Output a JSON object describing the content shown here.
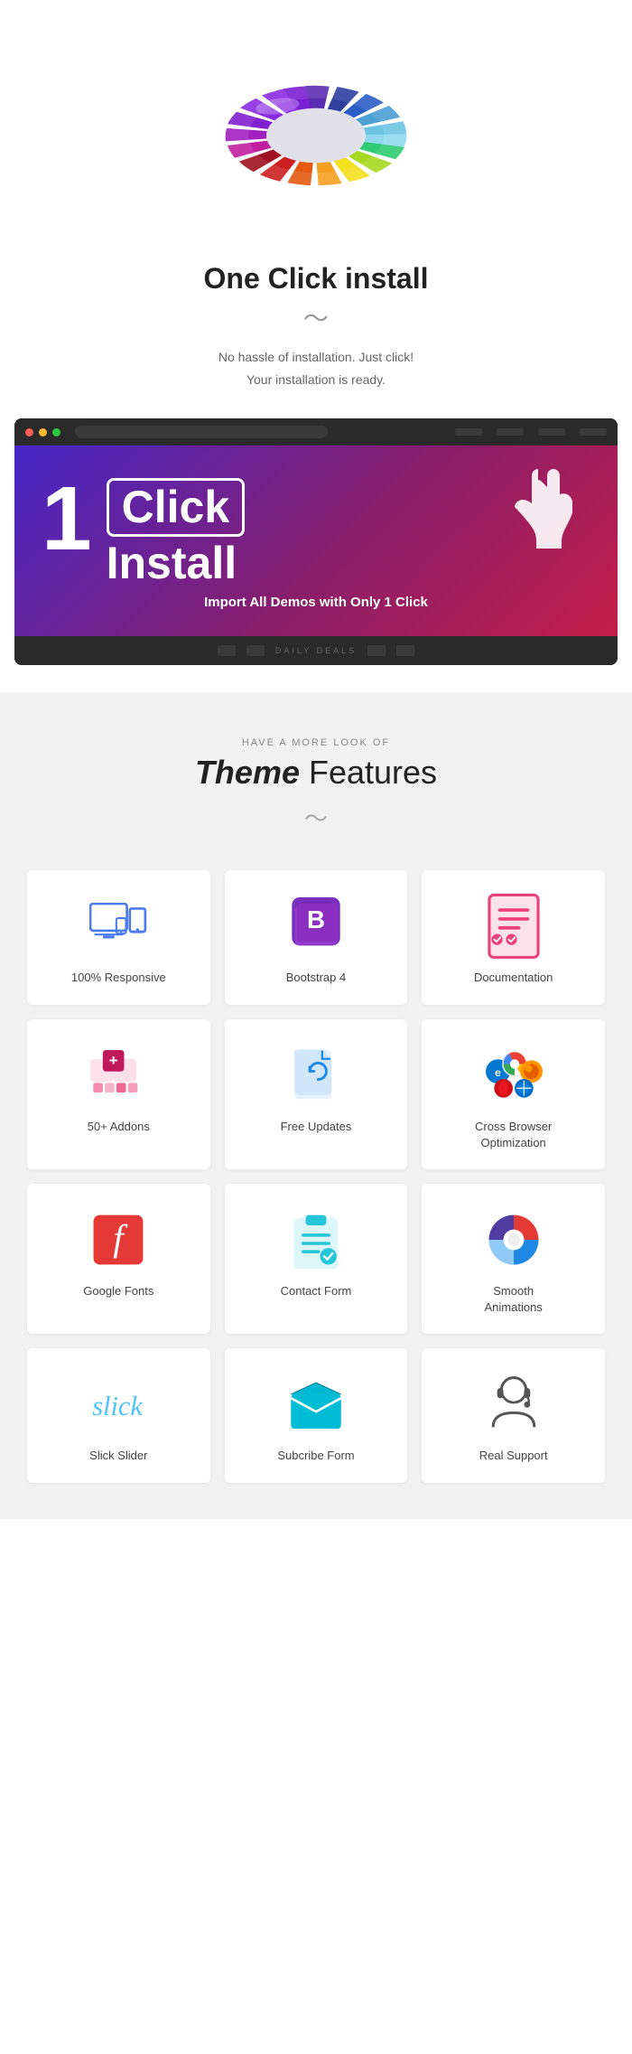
{
  "hero": {
    "title_bold": "One Click install",
    "divider_char": "〜",
    "desc_line1": "No hassle of installation. Just click!",
    "desc_line2": "Your installation is ready."
  },
  "install": {
    "number": "1",
    "click_label": "Click",
    "install_label": "Install",
    "subtitle": "Import All Demos with Only 1 Click",
    "bottom_text": "DAILY DEALS"
  },
  "features": {
    "subtitle": "HAVE A MORE LOOK OF",
    "title_italic": "Theme",
    "title_rest": " Features",
    "items": [
      {
        "label": "100% Responsive",
        "icon": "responsive"
      },
      {
        "label": "Bootstrap 4",
        "icon": "bootstrap"
      },
      {
        "label": "Documentation",
        "icon": "documentation"
      },
      {
        "label": "50+  Addons",
        "icon": "addons"
      },
      {
        "label": "Free Updates",
        "icon": "updates"
      },
      {
        "label": "Cross Browser\nOptimization",
        "icon": "browser"
      },
      {
        "label": "Google Fonts",
        "icon": "fonts"
      },
      {
        "label": "Contact Form",
        "icon": "contact"
      },
      {
        "label": "Smooth\nAnimations",
        "icon": "smooth"
      },
      {
        "label": "Slick Slider",
        "icon": "slick"
      },
      {
        "label": "Subcribe Form",
        "icon": "subscribe"
      },
      {
        "label": "Real Support",
        "icon": "support"
      }
    ]
  }
}
